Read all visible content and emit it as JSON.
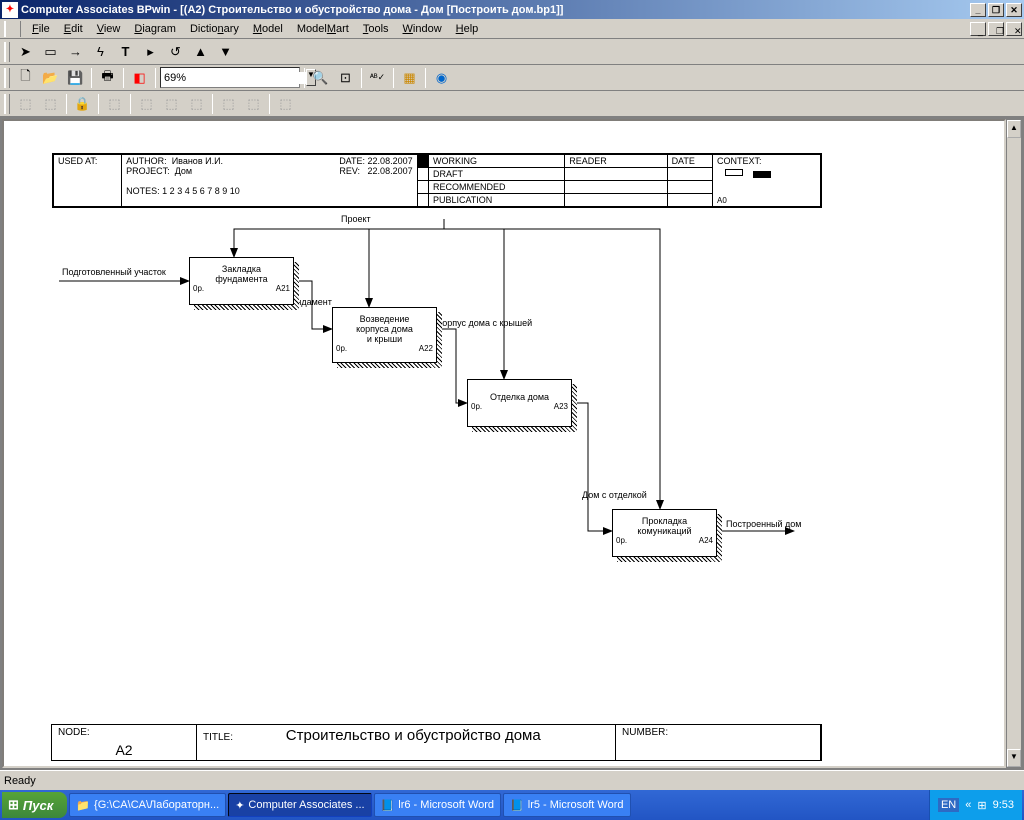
{
  "title": "Computer Associates BPwin - [(A2) Строительство  и обустройство  дома - Дом  [Построить дом.bp1]]",
  "menu": {
    "file": "File",
    "edit": "Edit",
    "view": "View",
    "diagram": "Diagram",
    "dictionary": "Dictionary",
    "model": "Model",
    "modelmart": "ModelMart",
    "tools": "Tools",
    "window": "Window",
    "help": "Help"
  },
  "zoom": "69%",
  "status": "Ready",
  "header": {
    "used_at": "USED AT:",
    "author_l": "AUTHOR:",
    "author": "Иванов И.И.",
    "date_l": "DATE:",
    "date": "22.08.2007",
    "project_l": "PROJECT:",
    "project": "Дом",
    "rev_l": "REV:",
    "rev": "22.08.2007",
    "notes": "NOTES:  1  2  3  4  5  6  7  8  9  10",
    "working": "WORKING",
    "draft": "DRAFT",
    "recommended": "RECOMMENDED",
    "publication": "PUBLICATION",
    "reader": "READER",
    "dateh": "DATE",
    "context": "CONTEXT:",
    "a0": "A0"
  },
  "footer": {
    "node_l": "NODE:",
    "node": "A2",
    "title_l": "TITLE:",
    "title": "Строительство  и обустройство  дома",
    "number_l": "NUMBER:"
  },
  "labels": {
    "proj": "Проект",
    "input": "Подготовленный участок",
    "fund": "Фундамент",
    "korp": "Корпус дома с крышей",
    "otd": "Дом с отделкой",
    "out": "Построенный дом"
  },
  "acts": {
    "a21": {
      "t": "Закладка\nфундамента",
      "p": "0р.",
      "n": "A21"
    },
    "a22": {
      "t": "Возведение\nкорпуса дома\nи крыши",
      "p": "0р.",
      "n": "A22"
    },
    "a23": {
      "t": "Отделка дома",
      "p": "0р.",
      "n": "A23"
    },
    "a24": {
      "t": "Прокладка\nкомуникаций",
      "p": "0р.",
      "n": "A24"
    }
  },
  "taskbar": {
    "start": "Пуск",
    "t1": "{G:\\CA\\CA\\Лабораторн...",
    "t2": "Computer Associates ...",
    "t3": "lr6 - Microsoft Word",
    "t4": "lr5 - Microsoft Word",
    "lang": "EN",
    "time": "9:53"
  }
}
